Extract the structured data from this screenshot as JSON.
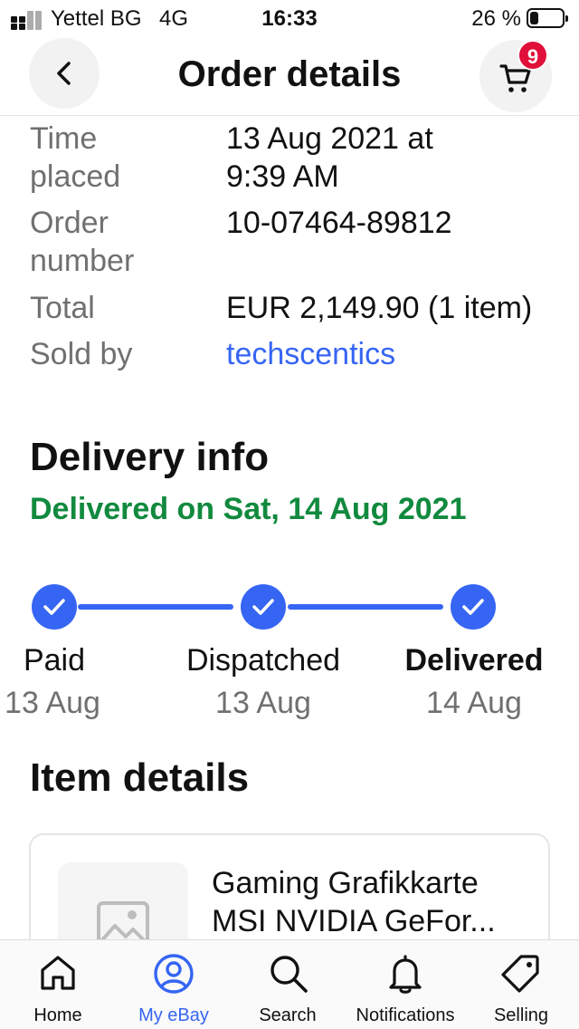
{
  "status_bar": {
    "carrier": "Yettel BG",
    "network": "4G",
    "time": "16:33",
    "battery_percent_label": "26 %",
    "battery_level": 0.26
  },
  "header": {
    "title": "Order details",
    "back_icon": "chevron-left-icon",
    "cart_icon": "cart-icon",
    "cart_badge": "9",
    "badge_color": "#e0103a"
  },
  "order_summary": {
    "time_placed_label_1": "Time",
    "time_placed_label_2": "placed",
    "time_placed_value_1": "13 Aug 2021 at",
    "time_placed_value_2": "9:39 AM",
    "order_number_label_1": "Order",
    "order_number_label_2": "number",
    "order_number_value": "10-07464-89812",
    "total_label": "Total",
    "total_value": "EUR 2,149.90 (1 item)",
    "sold_by_label": "Sold by",
    "sold_by_value": "techscentics"
  },
  "delivery_info": {
    "title": "Delivery info",
    "status": "Delivered on Sat, 14 Aug 2021",
    "status_color": "#118a3e",
    "accent_color": "#3665f3",
    "steps": [
      {
        "label": "Paid",
        "date": "13 Aug",
        "icon": "check-icon"
      },
      {
        "label": "Dispatched",
        "date": "13 Aug",
        "icon": "check-icon"
      },
      {
        "label": "Delivered",
        "date": "14 Aug",
        "icon": "check-icon"
      }
    ]
  },
  "item_details": {
    "title": "Item details",
    "item_title_line_1": "Gaming Grafikkarte",
    "item_title_line_2": "MSI NVIDIA GeFor...",
    "image_icon": "image-placeholder-icon"
  },
  "bottom_nav": {
    "items": [
      {
        "label": "Home",
        "icon": "home-icon"
      },
      {
        "label": "My eBay",
        "icon": "user-icon"
      },
      {
        "label": "Search",
        "icon": "search-icon"
      },
      {
        "label": "Notifications",
        "icon": "bell-icon"
      },
      {
        "label": "Selling",
        "icon": "tag-icon"
      }
    ],
    "active": "My eBay"
  }
}
